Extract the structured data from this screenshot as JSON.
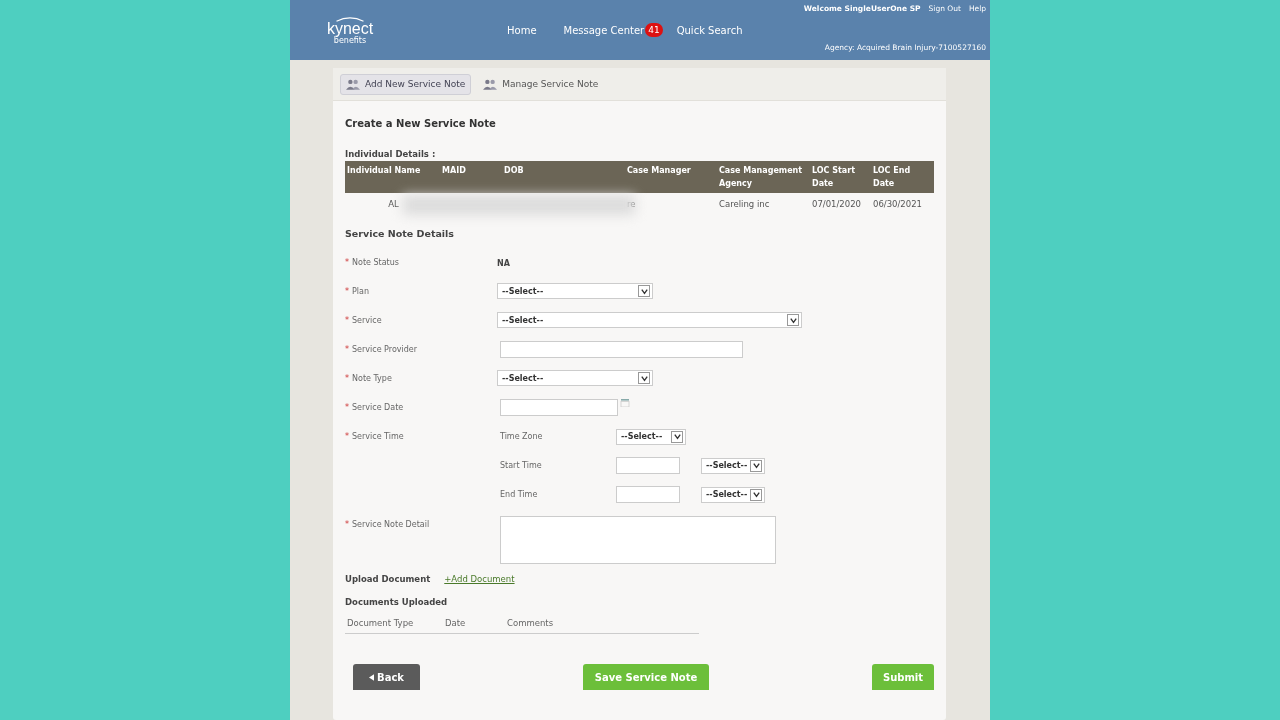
{
  "header": {
    "logo": "kynect",
    "logo_sub": "benefits",
    "nav": [
      {
        "label": "Home"
      },
      {
        "label": "Message Center",
        "badge": "41"
      },
      {
        "label": "Quick Search"
      }
    ],
    "welcome": "Welcome SingleUserOne SP",
    "links": [
      "Sign Out",
      "Help"
    ],
    "agency": "Agency: Acquired Brain Injury-7100527160"
  },
  "tabs": [
    {
      "label": "Add New Service Note",
      "selected": true
    },
    {
      "label": "Manage Service Note",
      "selected": false
    }
  ],
  "title": "Create a New Service Note",
  "individual": {
    "label": "Individual Details :",
    "columns": [
      {
        "label": "Individual Name",
        "cell": "AL"
      },
      {
        "label": "MAID"
      },
      {
        "label": "DOB"
      },
      {
        "label": "Case Manager",
        "cell": "re"
      },
      {
        "label": "Case Management Agency",
        "cell": "Careling inc"
      },
      {
        "label": "LOC Start Date",
        "cell": "07/01/2020"
      },
      {
        "label": "LOC End Date",
        "cell": "06/30/2021"
      }
    ]
  },
  "details_title": "Service Note Details",
  "fields": [
    {
      "kind": "status",
      "mark": "*",
      "label": "Note Status",
      "value": "NA"
    },
    {
      "kind": "select",
      "mark": "*",
      "label": "Plan",
      "value": "--Select--"
    },
    {
      "kind": "wide_select",
      "mark": "*",
      "label": "Service",
      "value": "--Select--"
    },
    {
      "kind": "text",
      "mark": "*",
      "label": "Service Provider"
    },
    {
      "kind": "select",
      "mark": "*",
      "label": "Note Type",
      "value": "--Select--"
    },
    {
      "kind": "date",
      "mark": "*",
      "label": "Service Date"
    },
    {
      "kind": "time",
      "mark": "*",
      "label": "Service Time",
      "parts": [
        {
          "kind": "select",
          "label": "Time Zone",
          "value": "--Select--"
        },
        {
          "kind": "input_select",
          "label": "Start Time",
          "value": "--Select--"
        },
        {
          "kind": "input_select",
          "label": "End Time",
          "value": "--Select--"
        }
      ]
    },
    {
      "kind": "textarea",
      "mark": "*",
      "label": "Service Note Detail"
    }
  ],
  "upload": {
    "label": "Upload Document",
    "link": "+Add Document"
  },
  "documents": {
    "title": "Documents Uploaded",
    "columns": [
      "Document Type",
      "Date",
      "Comments"
    ]
  },
  "buttons": [
    {
      "label": "Back",
      "kind": "back"
    },
    {
      "label": "Save Service Note",
      "kind": "save"
    },
    {
      "label": "Submit",
      "kind": "submit"
    }
  ]
}
